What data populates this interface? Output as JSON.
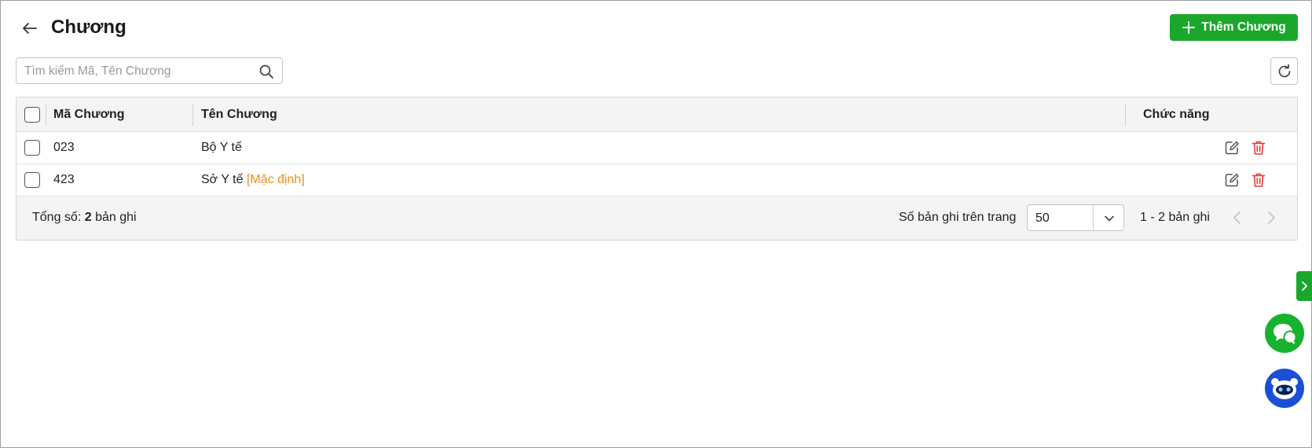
{
  "header": {
    "title": "Chương",
    "add_button_label": "Thêm Chương"
  },
  "search": {
    "placeholder": "Tìm kiếm Mã, Tên Chương",
    "value": ""
  },
  "table": {
    "columns": {
      "code": "Mã Chương",
      "name": "Tên Chương",
      "actions": "Chức năng"
    },
    "rows": [
      {
        "code": "023",
        "name": "Bộ Y tế",
        "tag": ""
      },
      {
        "code": "423",
        "name": "Sở Y tế",
        "tag": "[Mặc định]"
      }
    ]
  },
  "footer": {
    "total_label": "Tổng số:",
    "total_count": "2",
    "total_unit": "bản ghi",
    "per_page_label": "Số bản ghi trên trang",
    "per_page_value": "50",
    "range_text": "1 - 2 bản ghi"
  },
  "colors": {
    "primary": "#1aa72c",
    "default_tag": "#f28c18",
    "delete": "#e53935",
    "bot": "#1b4fd6"
  },
  "icons": {
    "back": "arrow-left-icon",
    "add": "plus-icon",
    "search": "search-icon",
    "refresh": "refresh-icon",
    "edit": "edit-icon",
    "delete": "trash-icon",
    "per_page": "chevron-down-icon",
    "prev": "chevron-left-icon",
    "next": "chevron-right-icon",
    "side_tab": "chevron-right-icon",
    "chat": "chat-icon",
    "bot": "bot-icon"
  }
}
